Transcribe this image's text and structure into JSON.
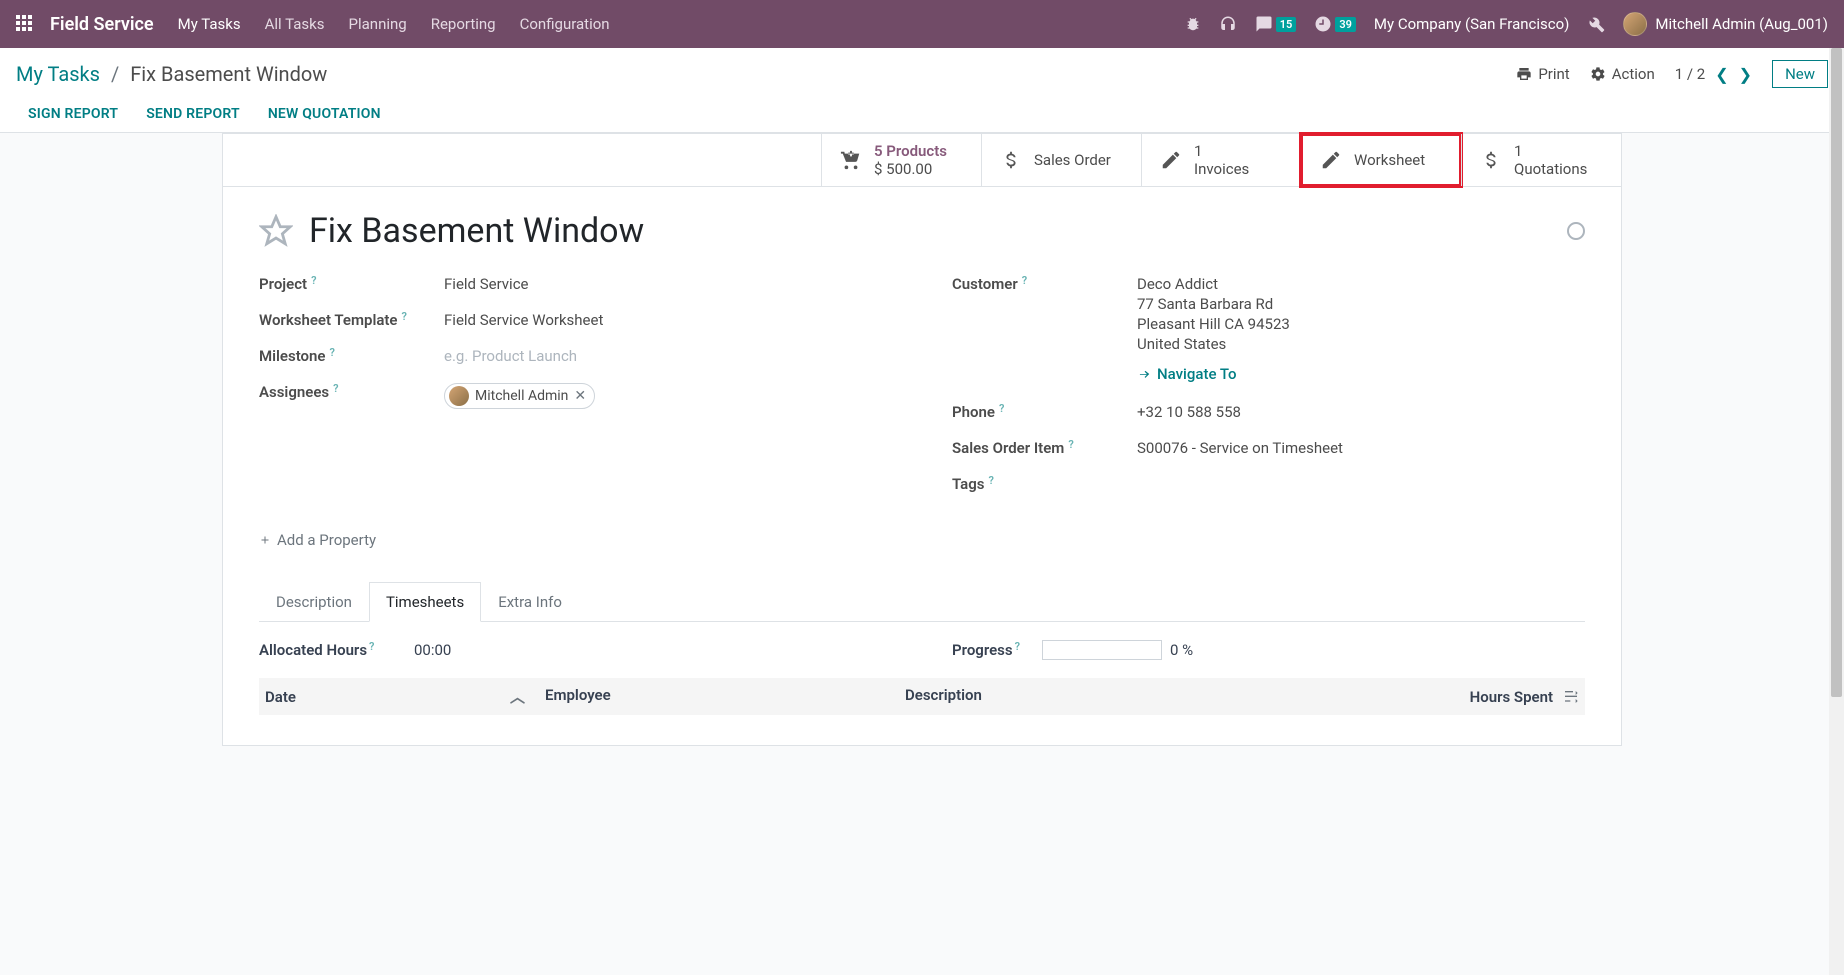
{
  "topbar": {
    "brand": "Field Service",
    "nav": [
      "My Tasks",
      "All Tasks",
      "Planning",
      "Reporting",
      "Configuration"
    ],
    "messages_badge": "15",
    "activities_badge": "39",
    "company": "My Company (San Francisco)",
    "user": "Mitchell Admin (Aug_001)"
  },
  "breadcrumb": {
    "root": "My Tasks",
    "current": "Fix Basement Window"
  },
  "cp": {
    "print": "Print",
    "action": "Action",
    "pager": "1 / 2",
    "new": "New",
    "status_actions": [
      "SIGN REPORT",
      "SEND REPORT",
      "NEW QUOTATION"
    ]
  },
  "stats": {
    "products": {
      "title": "5 Products",
      "sub": "$ 500.00"
    },
    "sales_order": {
      "title": "Sales Order"
    },
    "invoices": {
      "count": "1",
      "label": "Invoices"
    },
    "worksheet": {
      "label": "Worksheet"
    },
    "quotations": {
      "count": "1",
      "label": "Quotations"
    }
  },
  "task": {
    "title": "Fix Basement Window",
    "labels": {
      "project": "Project",
      "worksheet_template": "Worksheet Template",
      "milestone": "Milestone",
      "assignees": "Assignees",
      "customer": "Customer",
      "phone": "Phone",
      "sales_order_item": "Sales Order Item",
      "tags": "Tags",
      "add_property": "Add a Property",
      "navigate_to": "Navigate To"
    },
    "values": {
      "project": "Field Service",
      "worksheet_template": "Field Service Worksheet",
      "milestone_placeholder": "e.g. Product Launch",
      "assignee_name": "Mitchell Admin",
      "customer_name": "Deco Addict",
      "customer_addr1": "77 Santa Barbara Rd",
      "customer_addr2": "Pleasant Hill CA 94523",
      "customer_country": "United States",
      "phone": "+32 10 588 558",
      "sales_order_item": "S00076 - Service on Timesheet"
    }
  },
  "tabs": {
    "items": [
      "Description",
      "Timesheets",
      "Extra Info"
    ],
    "active": 1
  },
  "timesheet": {
    "alloc_label": "Allocated Hours",
    "alloc_value": "00:00",
    "progress_label": "Progress",
    "progress_value": "0 %",
    "headers": {
      "date": "Date",
      "employee": "Employee",
      "description": "Description",
      "hours": "Hours Spent"
    }
  }
}
